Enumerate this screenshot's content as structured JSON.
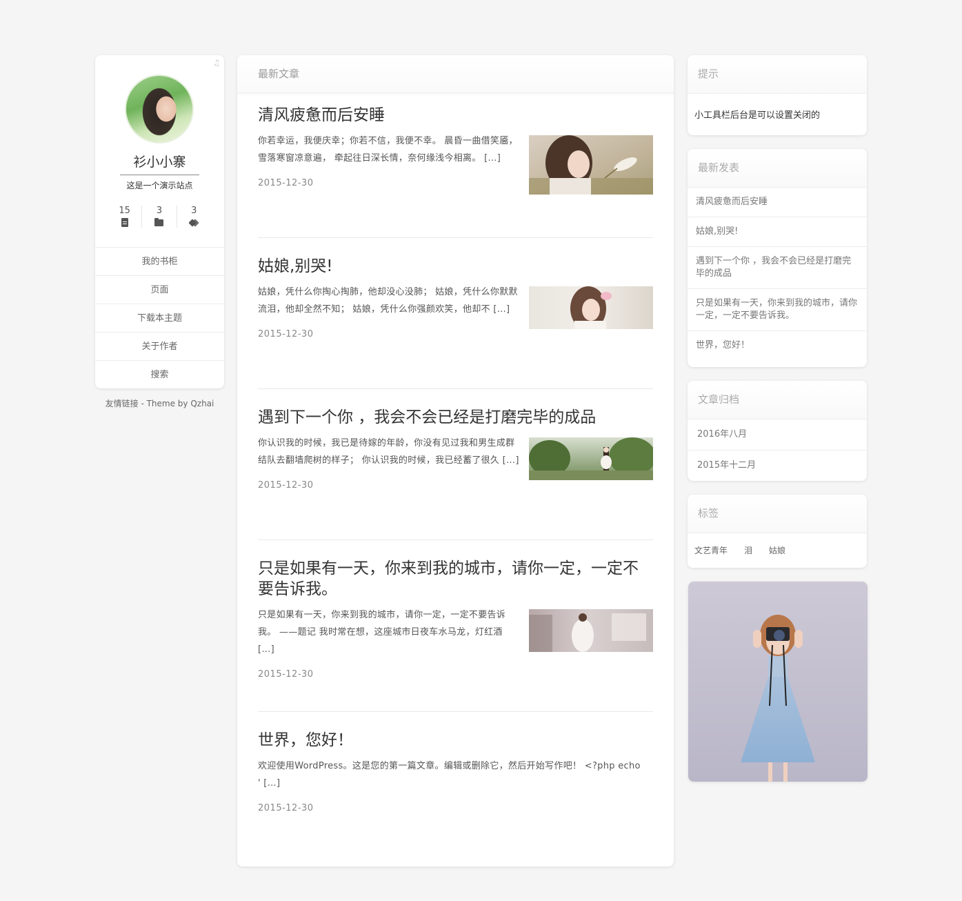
{
  "profile": {
    "site_name": "衫小小寨",
    "site_desc": "这是一个演示站点",
    "stats": [
      {
        "count": "15",
        "icon": "file-icon"
      },
      {
        "count": "3",
        "icon": "folder-icon"
      },
      {
        "count": "3",
        "icon": "tags-icon"
      }
    ],
    "nav": [
      "我的书柜",
      "页面",
      "下载本主题",
      "关于作者",
      "搜索"
    ],
    "footer_links": "友情链接",
    "footer_sep": " - ",
    "footer_theme": "Theme by Qzhai"
  },
  "main": {
    "header": "最新文章",
    "posts": [
      {
        "title": "清风疲惫而后安睡",
        "excerpt": "你若幸运，我便庆幸；你若不信，我便不幸。 晨昏一曲借笑靥，雪落寒窗凉意遍， 牵起往日深长情，奈何缘浅今相离。 […]",
        "date": "2015-12-30"
      },
      {
        "title": "姑娘,别哭!",
        "excerpt": "姑娘，凭什么你掏心掏肺，他却没心没肺； 姑娘，凭什么你默默流泪，他却全然不知； 姑娘，凭什么你强颜欢笑，他却不 […]",
        "date": "2015-12-30"
      },
      {
        "title": "遇到下一个你 ，我会不会已经是打磨完毕的成品",
        "excerpt": "你认识我的时候，我已是待嫁的年龄，你没有见过我和男生成群结队去翻墙爬树的样子； 你认识我的时候，我已经蓄了很久 […]",
        "date": "2015-12-30"
      },
      {
        "title": "只是如果有一天，你来到我的城市，请你一定，一定不要告诉我。",
        "excerpt": "只是如果有一天，你来到我的城市，请你一定，一定不要告诉我。 ——题记 我时常在想，这座城市日夜车水马龙，灯红酒 […]",
        "date": "2015-12-30"
      },
      {
        "title": "世界，您好！",
        "excerpt": "欢迎使用WordPress。这是您的第一篇文章。编辑或删除它，然后开始写作吧！ <?php echo ' […]",
        "date": "2015-12-30"
      }
    ]
  },
  "widgets": {
    "tip": {
      "title": "提示",
      "text": "小工具栏后台是可以设置关闭的"
    },
    "recent": {
      "title": "最新发表",
      "items": [
        "清风疲惫而后安睡",
        "姑娘,别哭!",
        "遇到下一个你 ，我会不会已经是打磨完毕的成品",
        "只是如果有一天，你来到我的城市，请你一定，一定不要告诉我。",
        "世界，您好！"
      ]
    },
    "archive": {
      "title": "文章归档",
      "items": [
        "2016年八月",
        "2015年十二月"
      ]
    },
    "tags": {
      "title": "标签",
      "items": [
        "文艺青年",
        "泪",
        "姑娘"
      ]
    }
  }
}
